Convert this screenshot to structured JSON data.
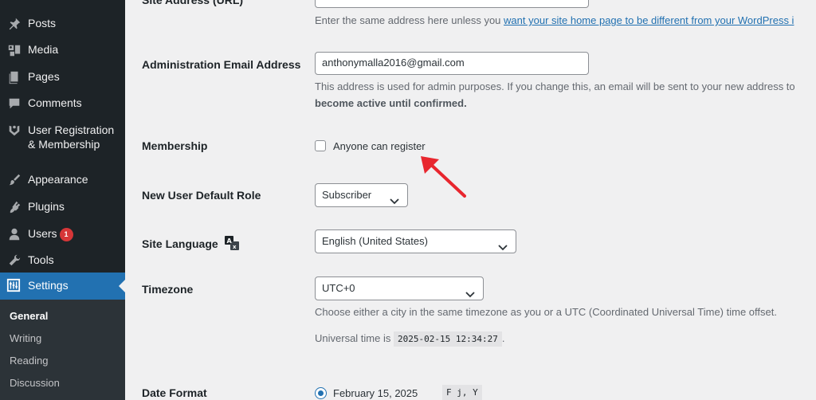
{
  "sidebar": {
    "items": [
      {
        "label": "Posts",
        "icon": "pin-icon"
      },
      {
        "label": "Media",
        "icon": "media-icon"
      },
      {
        "label": "Pages",
        "icon": "pages-icon"
      },
      {
        "label": "Comments",
        "icon": "comment-icon"
      },
      {
        "label_line1": "User Registration",
        "label_line2": "& Membership",
        "icon": "user-registration-icon"
      },
      {
        "label": "Appearance",
        "icon": "brush-icon"
      },
      {
        "label": "Plugins",
        "icon": "plugin-icon"
      },
      {
        "label": "Users",
        "icon": "user-icon",
        "badge": "1"
      },
      {
        "label": "Tools",
        "icon": "wrench-icon"
      },
      {
        "label": "Settings",
        "icon": "settings-icon",
        "active": true
      }
    ],
    "submenu": [
      "General",
      "Writing",
      "Reading",
      "Discussion"
    ]
  },
  "site_address": {
    "label": "Site Address (URL)",
    "desc_text": "Enter the same address here unless you ",
    "desc_link": "want your site home page to be different from your WordPress i"
  },
  "admin_email": {
    "label": "Administration Email Address",
    "value": "anthonymalla2016@gmail.com",
    "desc_line1": "This address is used for admin purposes. If you change this, an email will be sent to your new address to",
    "desc_line2": "become active until confirmed."
  },
  "membership": {
    "label": "Membership",
    "checkbox_label": "Anyone can register",
    "checked": false
  },
  "default_role": {
    "label": "New User Default Role",
    "value": "Subscriber"
  },
  "site_language": {
    "label": "Site Language",
    "value": "English (United States)"
  },
  "timezone": {
    "label": "Timezone",
    "value": "UTC+0",
    "desc": "Choose either a city in the same timezone as you or a UTC (Coordinated Universal Time) time offset.",
    "universal_prefix": "Universal time is",
    "universal_time": "2025-02-15 12:34:27",
    "universal_suffix": "."
  },
  "date_format": {
    "label": "Date Format",
    "option_label": "February 15, 2025",
    "option_code": "F j, Y"
  },
  "colors": {
    "sidebar_bg": "#1d2327",
    "accent": "#2271b1",
    "annotation_arrow": "#e8262e"
  }
}
